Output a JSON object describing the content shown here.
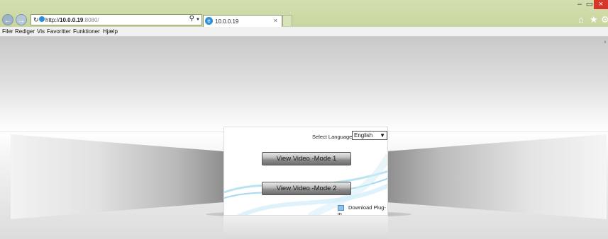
{
  "browser": {
    "url_prefix": "http://",
    "url_host": "10.0.0.19",
    "url_port": ":8080/",
    "tab_title": "10.0.0.19",
    "tab_close": "×",
    "window_minimize": "–",
    "window_restore": "▭",
    "window_close": "×"
  },
  "menu": [
    "Filer",
    "Rediger",
    "Vis",
    "Favoritter",
    "Funktioner",
    "Hjælp"
  ],
  "panel": {
    "language_label": "Select Language :",
    "language_value": "English",
    "button1": "View Video -Mode 1",
    "button2": "View Video -Mode 2",
    "download_label": "Download Plug-in"
  },
  "colors": {
    "chrome": "#cbd7a3",
    "close": "#d9362a",
    "wave": "#8fd0ea"
  }
}
